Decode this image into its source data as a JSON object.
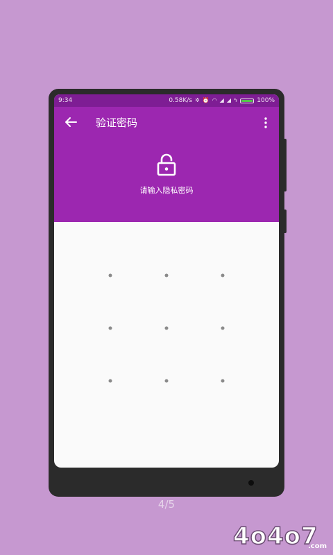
{
  "status": {
    "time": "9:34",
    "net_speed": "0.58K/s",
    "battery": "100%"
  },
  "header": {
    "title": "验证密码",
    "hint": "请输入隐私密码",
    "color": "#9c27b0"
  },
  "pattern": {
    "rows": 3,
    "cols": 3
  },
  "page_indicator": "4/5",
  "watermark": "4o4o7.com"
}
